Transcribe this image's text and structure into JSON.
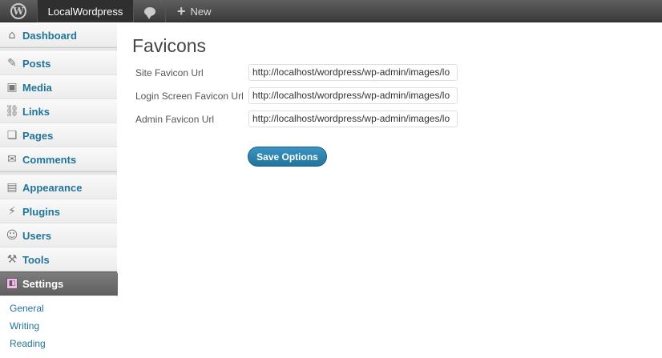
{
  "adminbar": {
    "logo_icon": "wordpress-logo-icon",
    "site_name": "LocalWordpress",
    "comments_icon": "comment-bubble-icon",
    "new_label": "New"
  },
  "sidebar": {
    "items": [
      {
        "label": "Dashboard",
        "icon": "dashboard-icon"
      },
      {
        "label": "Posts",
        "icon": "pin-icon"
      },
      {
        "label": "Media",
        "icon": "media-icon"
      },
      {
        "label": "Links",
        "icon": "link-icon"
      },
      {
        "label": "Pages",
        "icon": "pages-icon"
      },
      {
        "label": "Comments",
        "icon": "comments-icon"
      },
      {
        "label": "Appearance",
        "icon": "appearance-icon"
      },
      {
        "label": "Plugins",
        "icon": "plugin-icon"
      },
      {
        "label": "Users",
        "icon": "users-icon"
      },
      {
        "label": "Tools",
        "icon": "tools-icon"
      },
      {
        "label": "Settings",
        "icon": "settings-icon"
      }
    ],
    "submenu": [
      "General",
      "Writing",
      "Reading"
    ]
  },
  "page": {
    "title": "Favicons",
    "fields": [
      {
        "label": "Site Favicon Url",
        "value": "http://localhost/wordpress/wp-admin/images/lo"
      },
      {
        "label": "Login Screen Favicon Url",
        "value": "http://localhost/wordpress/wp-admin/images/lo"
      },
      {
        "label": "Admin Favicon Url",
        "value": "http://localhost/wordpress/wp-admin/images/lo"
      }
    ],
    "save_label": "Save Options"
  },
  "colors": {
    "link": "#21759b",
    "button": "#21759b",
    "adminbar": "#464646"
  }
}
